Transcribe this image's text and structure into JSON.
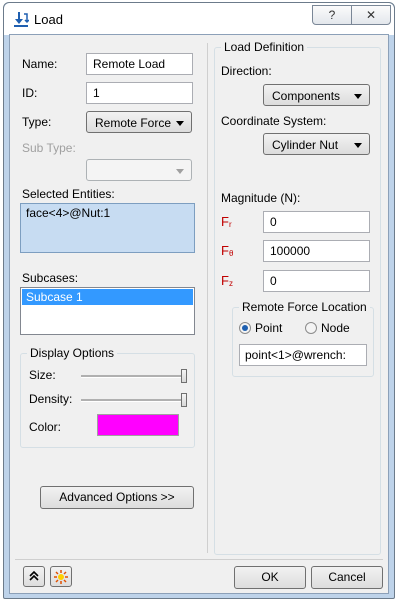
{
  "window": {
    "title": "Load",
    "help_glyph": "?",
    "close_glyph": "✕"
  },
  "left": {
    "name_label": "Name:",
    "name_value": "Remote Load",
    "id_label": "ID:",
    "id_value": "1",
    "type_label": "Type:",
    "type_value": "Remote Force",
    "subtype_label": "Sub Type:",
    "selected_entities_label": "Selected Entities:",
    "selected_entities": [
      "face<4>@Nut:1"
    ],
    "subcases_label": "Subcases:",
    "subcases": [
      "Subcase 1"
    ],
    "display_options": {
      "title": "Display Options",
      "size_label": "Size:",
      "density_label": "Density:",
      "color_label": "Color:",
      "color_value": "#ff00ff",
      "size_level": 1.0,
      "density_level": 1.0
    },
    "advanced_button": "Advanced Options >>"
  },
  "right": {
    "group_title": "Load Definition",
    "direction_label": "Direction:",
    "direction_value": "Components",
    "coord_label": "Coordinate System:",
    "coord_value": "Cylinder Nut",
    "magnitude_label": "Magnitude (N):",
    "components": [
      {
        "letter": "F",
        "sub": "r",
        "value": "0"
      },
      {
        "letter": "F",
        "sub": "θ",
        "value": "100000"
      },
      {
        "letter": "F",
        "sub": "z",
        "value": "0"
      }
    ],
    "location": {
      "title": "Remote Force Location",
      "point_label": "Point",
      "node_label": "Node",
      "selected": "point",
      "value": "point<1>@wrench:"
    }
  },
  "footer": {
    "ok_label": "OK",
    "cancel_label": "Cancel"
  },
  "colors": {
    "accent_red": "#c00000",
    "selection": "#3399ff",
    "entity_bg": "#c7dcf2"
  }
}
